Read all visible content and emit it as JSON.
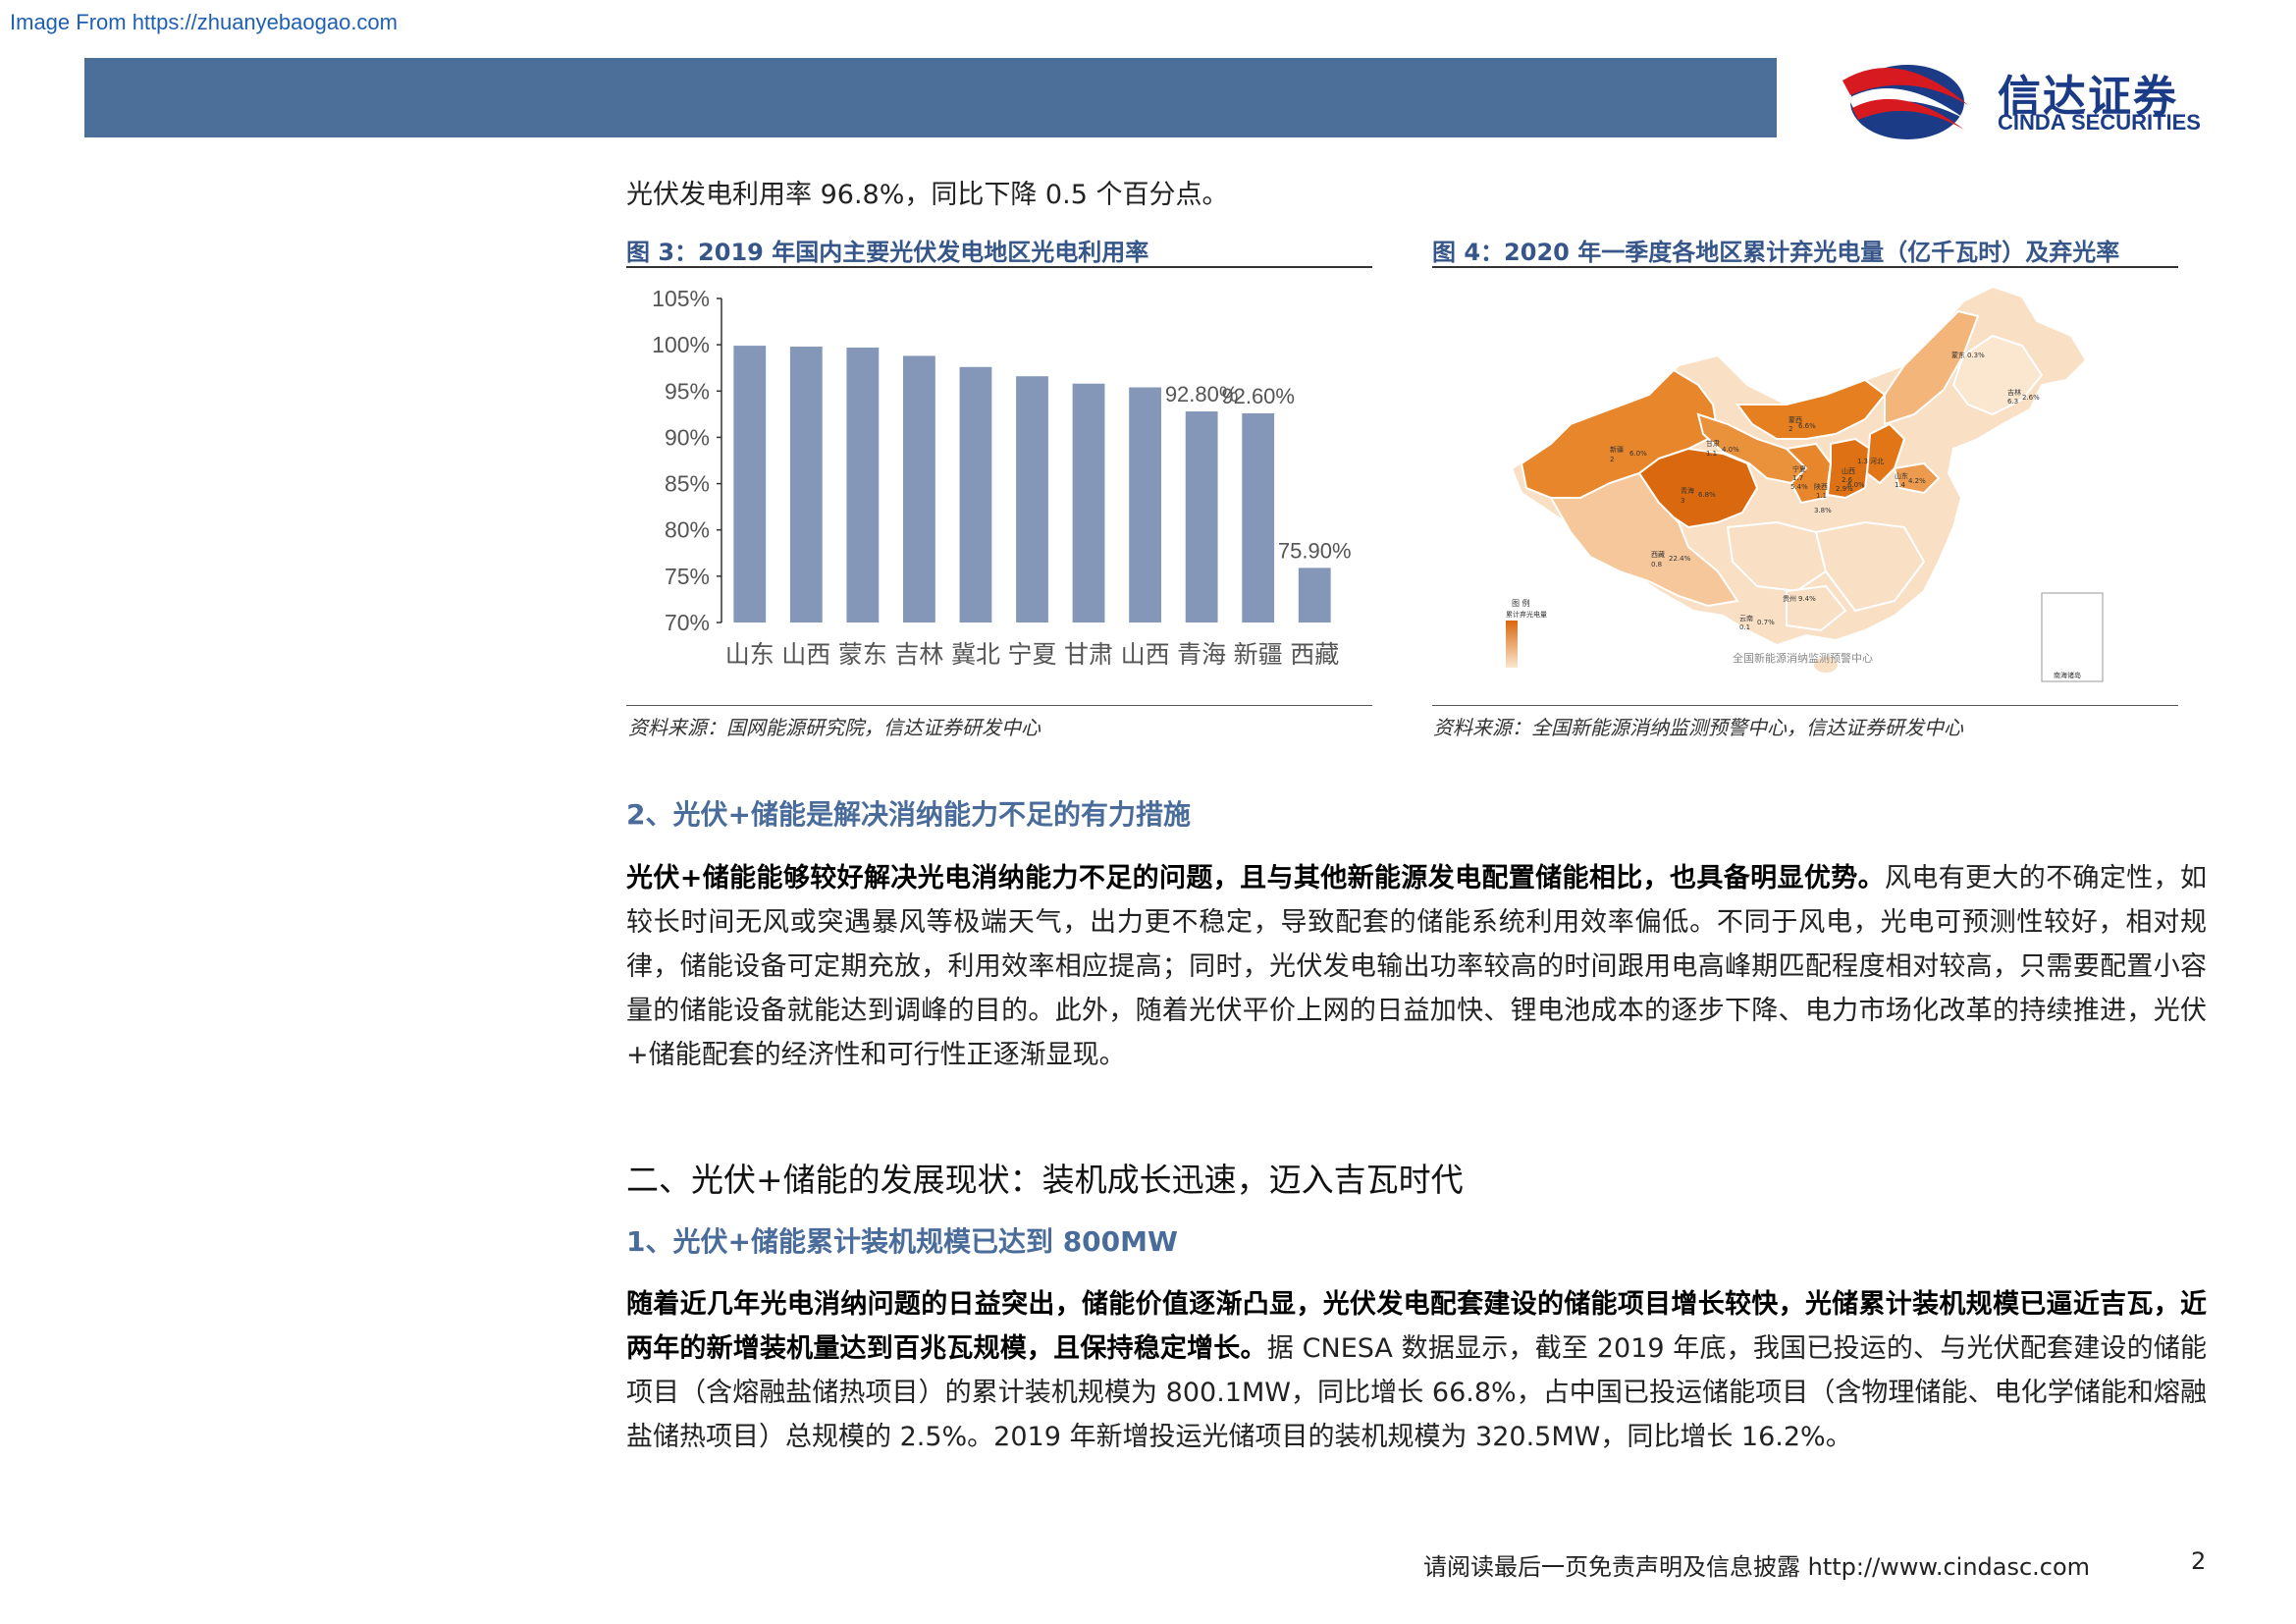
{
  "source_link": "Image From https://zhuanyebaogao.com",
  "logo": {
    "cn": "信达证券",
    "en": "CINDA SECURITIES"
  },
  "intro_text": "光伏发电利用率 96.8%，同比下降 0.5 个百分点。",
  "figure3": {
    "title": "图 3：2019 年国内主要光伏发电地区光电利用率",
    "source": "资料来源：国网能源研究院，信达证券研发中心"
  },
  "figure4": {
    "title": "图 4：2020 年一季度各地区累计弃光电量（亿千瓦时）及弃光率",
    "source": "资料来源：全国新能源消纳监测预警中心，信达证券研发中心",
    "legend_title": "图 例",
    "legend_sub": "累计弃光电量",
    "watermark": "全国新能源消纳监测预警中心",
    "inset_label": "南海诸岛",
    "labels": [
      {
        "name": "新疆",
        "v": "2",
        "r": "6.0%"
      },
      {
        "name": "甘肃",
        "v": "1.1",
        "r": "4.0%"
      },
      {
        "name": "青海",
        "v": "3",
        "r": "6.8%"
      },
      {
        "name": "西藏",
        "v": "0.8",
        "r": "22.4%"
      },
      {
        "name": "宁夏",
        "v": "1.7",
        "r": "5.4%"
      },
      {
        "name": "陕西",
        "v": "1.1",
        "r": "3.8%"
      },
      {
        "name": "山西",
        "v": "2.6",
        "r": "2.9%"
      },
      {
        "name": "河北",
        "v": "1.3",
        "r": "6.0%"
      },
      {
        "name": "山东",
        "v": "1.4",
        "r": "4.2%"
      },
      {
        "name": "蒙西",
        "v": "2",
        "r": "6.6%"
      },
      {
        "name": "蒙东",
        "v": "",
        "r": "0.3%"
      },
      {
        "name": "吉林",
        "v": "6.3",
        "r": "2.6%"
      },
      {
        "name": "云南",
        "v": "0.1",
        "r": "0.7%"
      },
      {
        "name": "贵州",
        "v": "",
        "r": "9.4%"
      }
    ]
  },
  "section_2_heading": "2、光伏+储能是解决消纳能力不足的有力措施",
  "para1_bold": "光伏+储能能够较好解决光电消纳能力不足的问题，且与其他新能源发电配置储能相比，也具备明显优势。",
  "para1_rest": "风电有更大的不确定性，如较长时间无风或突遇暴风等极端天气，出力更不稳定，导致配套的储能系统利用效率偏低。不同于风电，光电可预测性较好，相对规律，储能设备可定期充放，利用效率相应提高；同时，光伏发电输出功率较高的时间跟用电高峰期匹配程度相对较高，只需要配置小容量的储能设备就能达到调峰的目的。此外，随着光伏平价上网的日益加快、锂电池成本的逐步下降、电力市场化改革的持续推进，光伏+储能配套的经济性和可行性正逐渐显现。",
  "chapter_heading": "二、光伏+储能的发展现状：装机成长迅速，迈入吉瓦时代",
  "section_1_heading": "1、光伏+储能累计装机规模已达到 800MW",
  "para2_bold": "随着近几年光电消纳问题的日益突出，储能价值逐渐凸显，光伏发电配套建设的储能项目增长较快，光储累计装机规模已逼近吉瓦，近两年的新增装机量达到百兆瓦规模，且保持稳定增长。",
  "para2_rest": "据 CNESA 数据显示，截至 2019 年底，我国已投运的、与光伏配套建设的储能项目（含熔融盐储热项目）的累计装机规模为 800.1MW，同比增长 66.8%，占中国已投运储能项目（含物理储能、电化学储能和熔融盐储热项目）总规模的 2.5%。2019 年新增投运光储项目的装机规模为 320.5MW，同比增长 16.2%。",
  "footer_text": "请阅读最后一页免责声明及信息披露 http://www.cindasc.com",
  "page_number": "2",
  "colors": {
    "bar": "#8497b8",
    "header": "#4b6f99",
    "heading": "#4a6c9b",
    "map_dark": "#e27617",
    "map_light": "#f9dfc4"
  },
  "chart_data": {
    "type": "bar",
    "categories": [
      "山东",
      "山西",
      "蒙东",
      "吉林",
      "冀北",
      "宁夏",
      "甘肃",
      "山西",
      "青海",
      "新疆",
      "西藏"
    ],
    "values": [
      99.9,
      99.8,
      99.7,
      98.8,
      97.6,
      96.6,
      95.8,
      95.4,
      92.8,
      92.6,
      75.9
    ],
    "data_labels": [
      "",
      "",
      "",
      "",
      "",
      "",
      "",
      "",
      "92.80%",
      "92.60%",
      "75.90%"
    ],
    "ylim": [
      70,
      105
    ],
    "yticks": [
      105,
      100,
      95,
      90,
      85,
      80,
      75,
      70
    ],
    "ytick_labels": [
      "105%",
      "100%",
      "95%",
      "90%",
      "85%",
      "80%",
      "75%",
      "70%"
    ],
    "grid": false,
    "legend": "none"
  }
}
